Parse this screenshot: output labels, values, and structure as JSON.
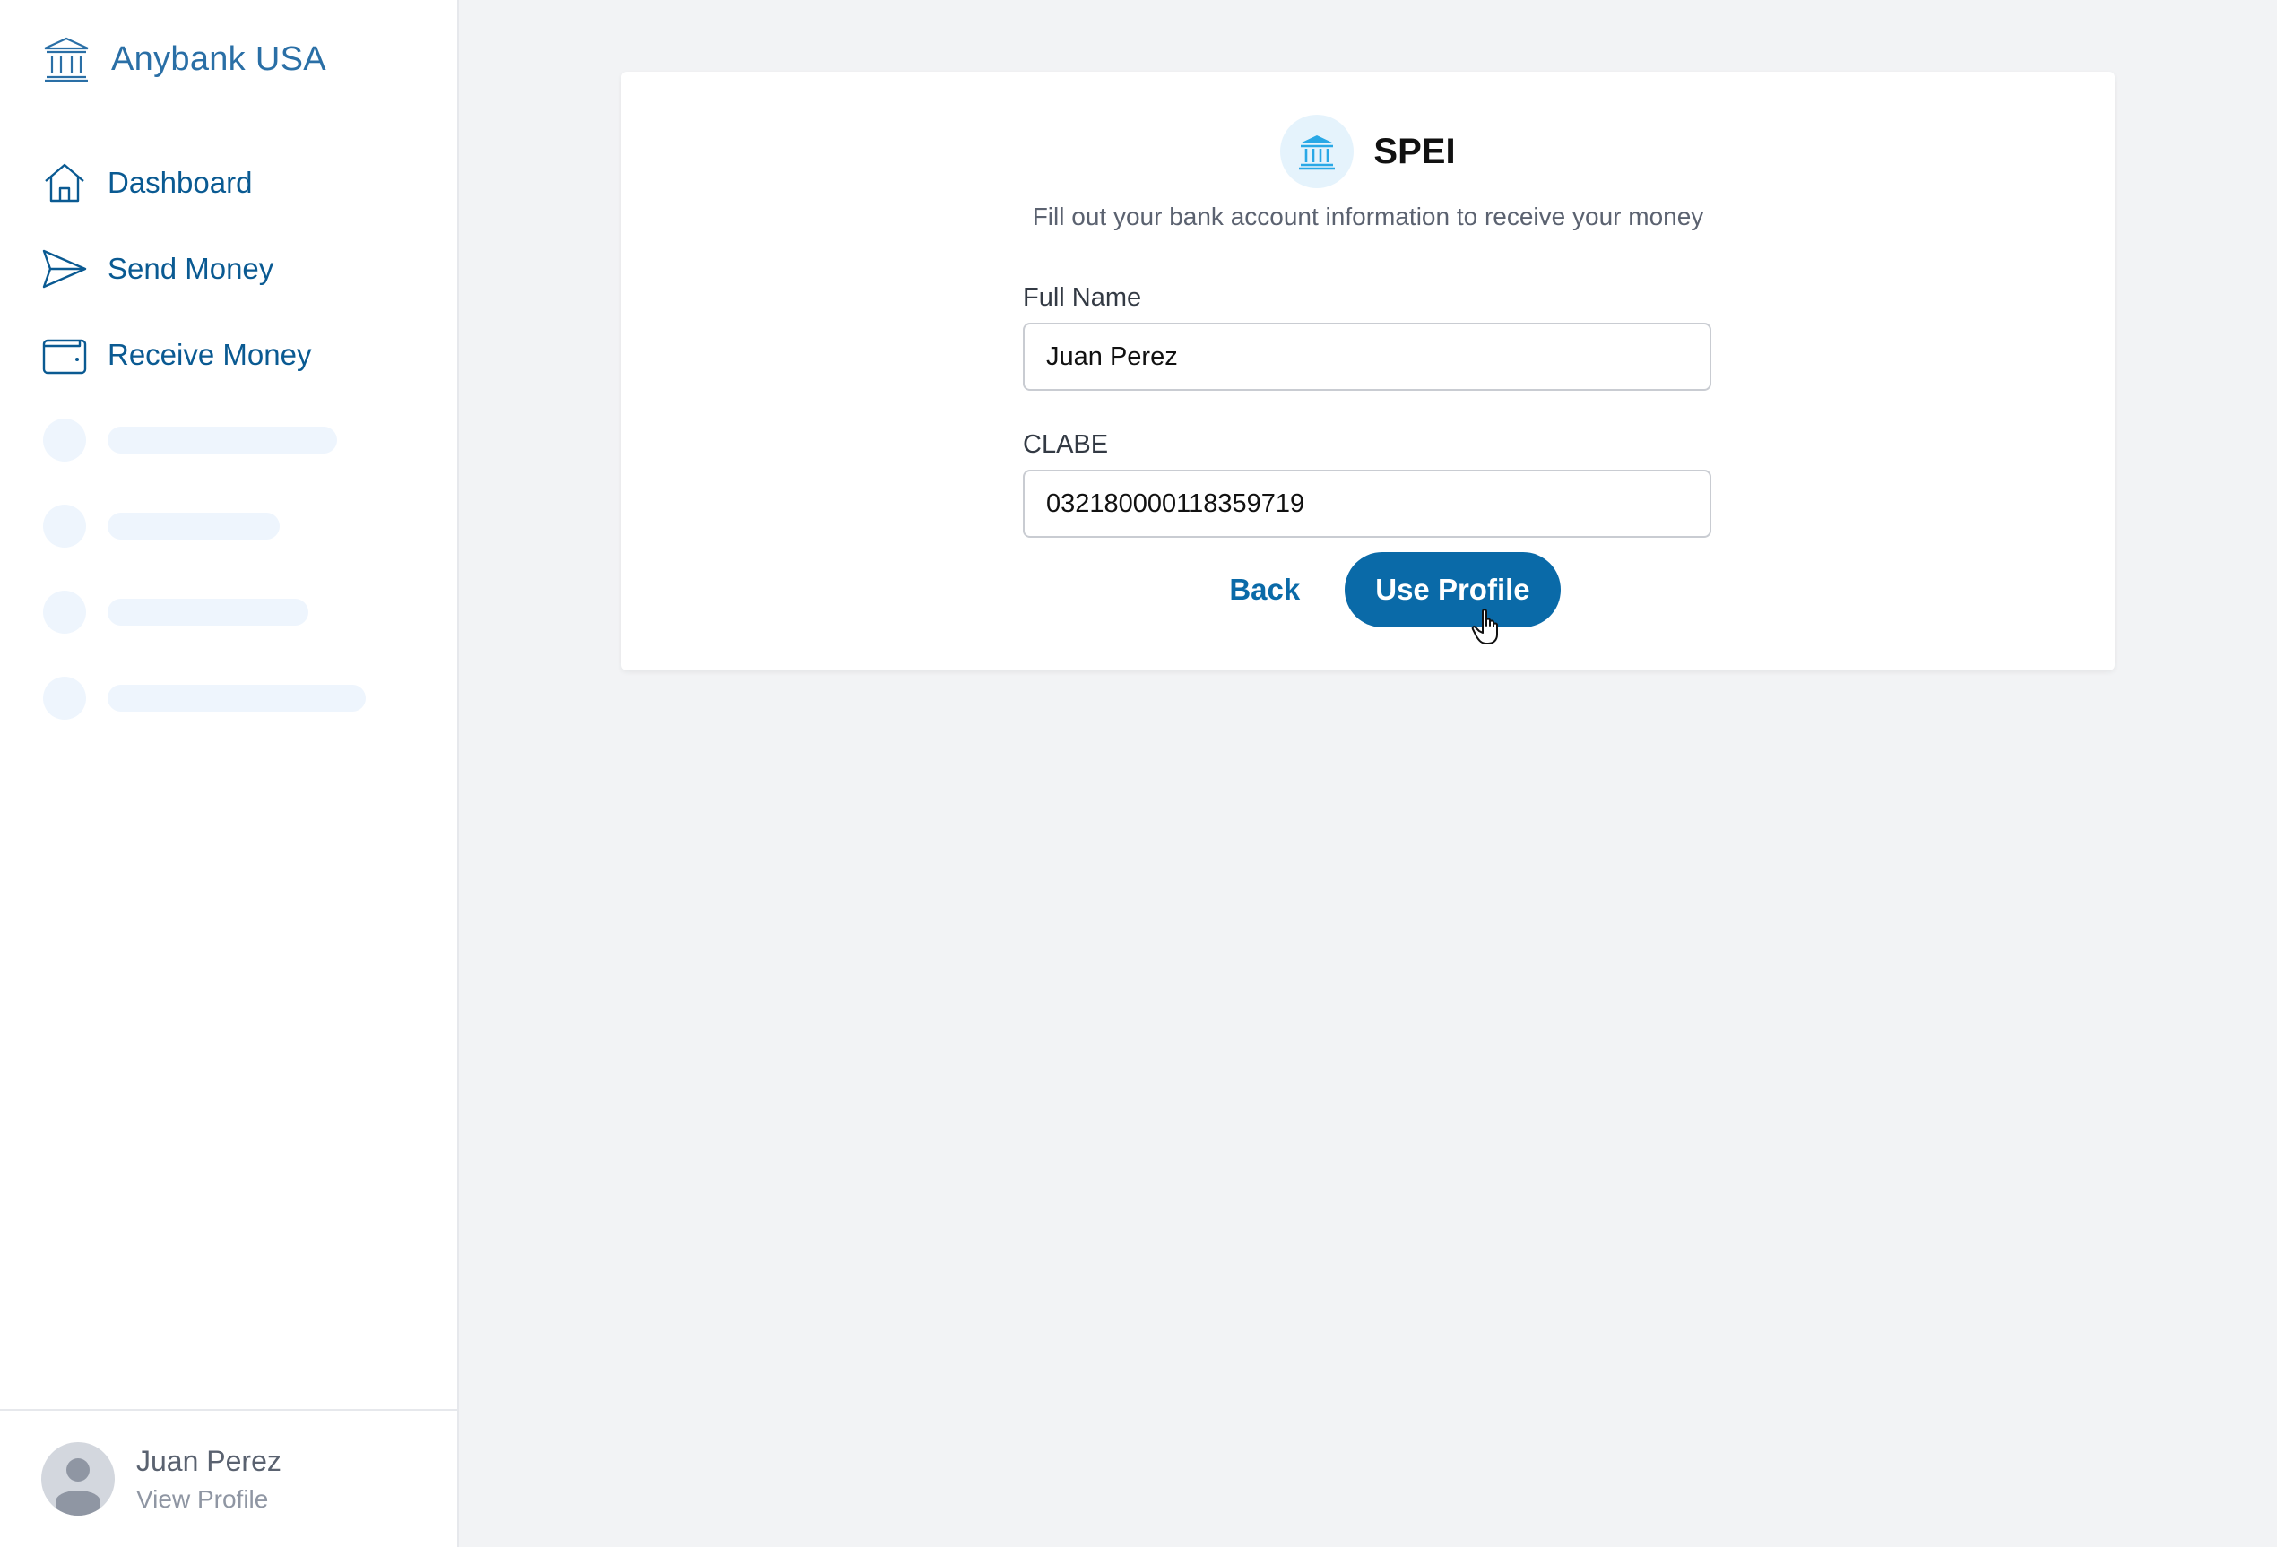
{
  "brand": {
    "name": "Anybank USA",
    "icon": "bank-icon"
  },
  "nav": {
    "items": [
      {
        "label": "Dashboard",
        "icon": "home-icon"
      },
      {
        "label": "Send Money",
        "icon": "paper-plane-icon"
      },
      {
        "label": "Receive Money",
        "icon": "wallet-icon"
      }
    ]
  },
  "user": {
    "name": "Juan Perez",
    "link": "View Profile"
  },
  "card": {
    "title": "SPEI",
    "subtitle": "Fill out your bank account information to receive your money",
    "full_name_label": "Full Name",
    "full_name_value": "Juan Perez",
    "clabe_label": "CLABE",
    "clabe_value": "032180000118359719",
    "back_label": "Back",
    "submit_label": "Use Profile"
  },
  "colors": {
    "accent": "#0a6aa8",
    "nav_text": "#0a5a92",
    "skeleton": "#eef5fd",
    "background": "#f2f3f5"
  }
}
